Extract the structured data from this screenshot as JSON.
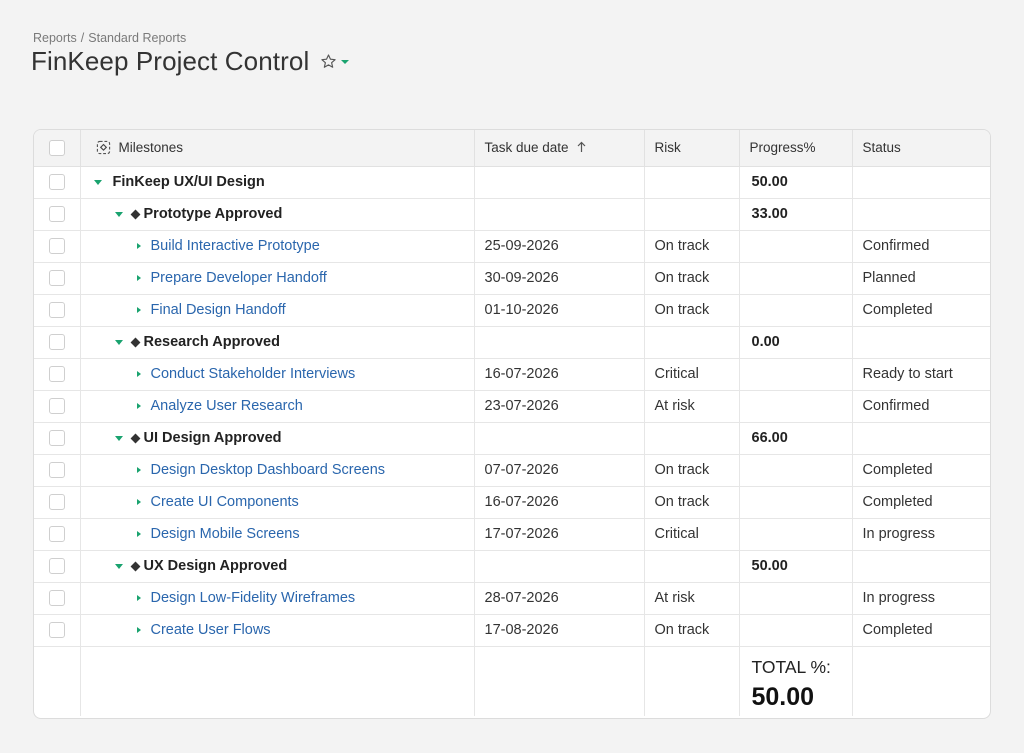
{
  "breadcrumb": {
    "items": [
      "Reports",
      "Standard Reports"
    ],
    "separator": "/"
  },
  "page": {
    "title": "FinKeep Project Control"
  },
  "icons": {
    "favorite": "star-icon",
    "menu": "caret-down-icon",
    "milestones": "milestones-icon",
    "sort": "sort-arrow-up-icon"
  },
  "colors": {
    "accent": "#1aa36f",
    "link": "#2a66ad",
    "background": "#f3f3f3"
  },
  "table": {
    "headers": {
      "milestones": "Milestones",
      "due_date": "Task due date",
      "risk": "Risk",
      "progress": "Progress%",
      "status": "Status"
    },
    "sort": {
      "column": "Task due date",
      "direction": "ascending"
    },
    "rows": [
      {
        "name": "FinKeep UX/UI Design",
        "date": "",
        "risk": "",
        "progress": "50.00",
        "status": ""
      },
      {
        "name": "Prototype Approved",
        "date": "",
        "risk": "",
        "progress": "33.00",
        "status": ""
      },
      {
        "name": "Build Interactive Prototype",
        "date": "25-09-2026",
        "risk": "On track",
        "progress": "",
        "status": "Confirmed"
      },
      {
        "name": "Prepare Developer Handoff",
        "date": "30-09-2026",
        "risk": "On track",
        "progress": "",
        "status": "Planned"
      },
      {
        "name": "Final Design Handoff",
        "date": "01-10-2026",
        "risk": "On track",
        "progress": "",
        "status": "Completed"
      },
      {
        "name": "Research Approved",
        "date": "",
        "risk": "",
        "progress": "0.00",
        "status": ""
      },
      {
        "name": "Conduct Stakeholder Interviews",
        "date": "16-07-2026",
        "risk": "Critical",
        "progress": "",
        "status": "Ready to start"
      },
      {
        "name": "Analyze User Research",
        "date": "23-07-2026",
        "risk": "At risk",
        "progress": "",
        "status": "Confirmed"
      },
      {
        "name": "UI Design Approved",
        "date": "",
        "risk": "",
        "progress": "66.00",
        "status": ""
      },
      {
        "name": "Design Desktop Dashboard Screens",
        "date": "07-07-2026",
        "risk": "On track",
        "progress": "",
        "status": "Completed"
      },
      {
        "name": "Create UI Components",
        "date": "16-07-2026",
        "risk": "On track",
        "progress": "",
        "status": "Completed"
      },
      {
        "name": "Design Mobile Screens",
        "date": "17-07-2026",
        "risk": "Critical",
        "progress": "",
        "status": "In progress"
      },
      {
        "name": "UX Design Approved",
        "date": "",
        "risk": "",
        "progress": "50.00",
        "status": ""
      },
      {
        "name": "Design Low-Fidelity Wireframes",
        "date": "28-07-2026",
        "risk": "At risk",
        "progress": "",
        "status": "In progress"
      },
      {
        "name": "Create User Flows",
        "date": "17-08-2026",
        "risk": "On track",
        "progress": "",
        "status": "Completed"
      }
    ],
    "total": {
      "label": "TOTAL %:",
      "value": "50.00"
    }
  }
}
